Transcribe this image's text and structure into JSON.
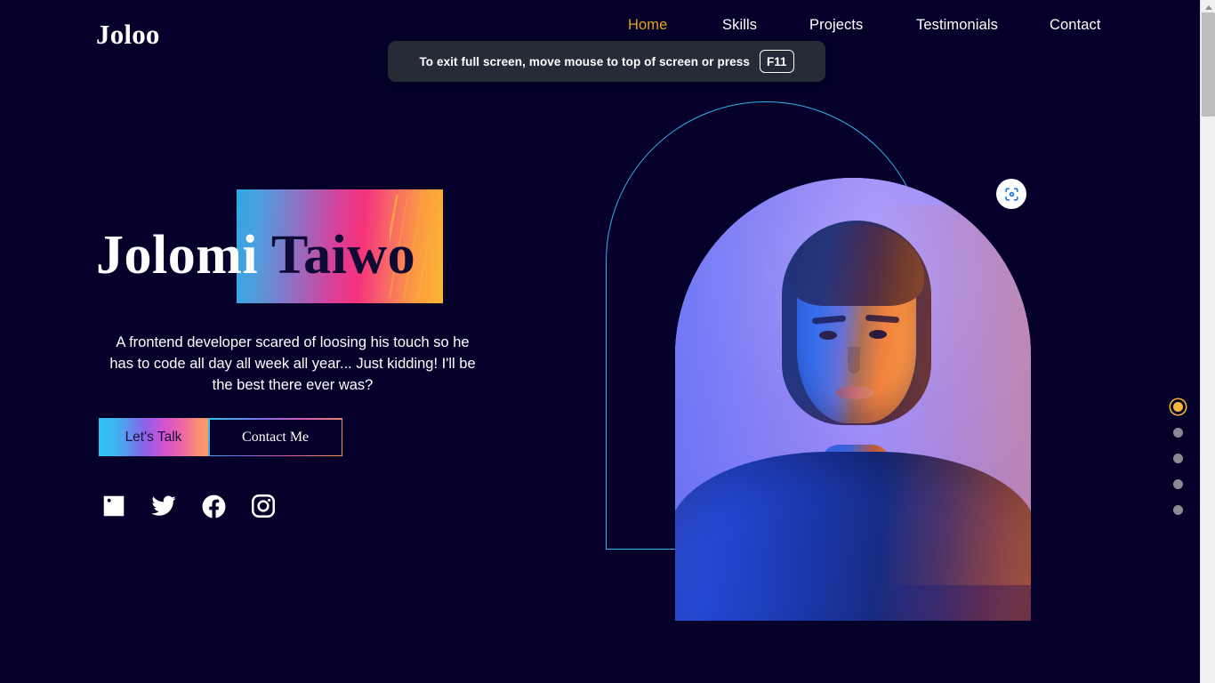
{
  "brand": {
    "name": "Joloo"
  },
  "nav": {
    "items": [
      {
        "label": "Home",
        "active": true
      },
      {
        "label": "Skills",
        "active": false
      },
      {
        "label": "Projects",
        "active": false
      },
      {
        "label": "Testimonials",
        "active": false
      },
      {
        "label": "Contact",
        "active": false
      }
    ],
    "active_color": "#e9a21f",
    "inactive_color": "#ffffff"
  },
  "fullscreen_toast": {
    "message": "To exit full screen, move mouse to top of screen or press",
    "key": "F11"
  },
  "hero": {
    "headline_first": "Jolomi ",
    "headline_last": "Taiwo",
    "description": "A frontend developer scared of loosing his touch so he has to code all day all week all year... Just kidding! I'll be the best there ever was?",
    "buttons": {
      "primary": "Let's Talk",
      "secondary": "Contact Me"
    },
    "socials": [
      {
        "name": "linkedin-icon"
      },
      {
        "name": "twitter-icon"
      },
      {
        "name": "facebook-icon"
      },
      {
        "name": "instagram-icon"
      }
    ],
    "photo_alt": "Portrait with blue and orange neon lighting",
    "lens_badge": "visual-search-icon"
  },
  "section_dots": {
    "count": 5,
    "active_index": 0,
    "active_color": "#f7b53a",
    "inactive_color": "#8a8a92"
  },
  "theme": {
    "background": "#04002a",
    "accent_cyan": "#31b4e8",
    "accent_amber": "#e9a21f",
    "text": "#ffffff"
  },
  "scrollbar": {
    "position": "top"
  }
}
